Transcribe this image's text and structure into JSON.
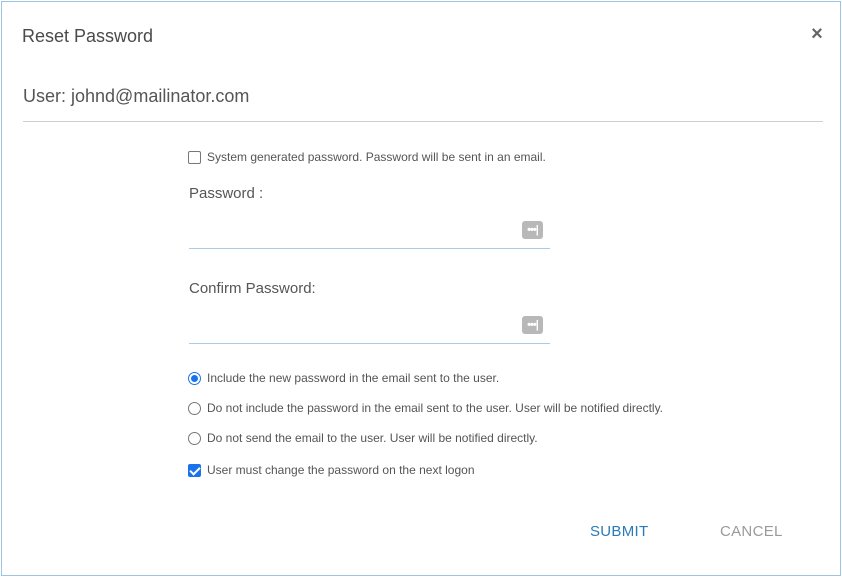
{
  "dialog": {
    "title": "Reset Password",
    "close_symbol": "×",
    "user_line": "User: johnd@mailinator.com"
  },
  "options": {
    "system_generated": {
      "label": "System generated password. Password will be sent in an email.",
      "checked": false
    },
    "radios": [
      {
        "label": "Include the new password in the email sent to the user.",
        "checked": true
      },
      {
        "label": "Do not include the password in the email sent to the user. User will be notified directly.",
        "checked": false
      },
      {
        "label": "Do not send the email to the user. User will be notified directly.",
        "checked": false
      }
    ],
    "must_change": {
      "label": "User must change the password on the next logon",
      "checked": true
    }
  },
  "fields": {
    "password": {
      "label": "Password :",
      "value": "",
      "icon": "password-dots-icon",
      "icon_glyph": "•••|"
    },
    "confirm": {
      "label": "Confirm Password:",
      "value": "",
      "icon": "password-dots-icon",
      "icon_glyph": "•••|"
    }
  },
  "buttons": {
    "submit": "SUBMIT",
    "cancel": "CANCEL"
  },
  "colors": {
    "accent": "#1a73e8",
    "submit": "#2a7ab8",
    "cancel": "#9a9a9a",
    "border": "#9cc4e4"
  }
}
